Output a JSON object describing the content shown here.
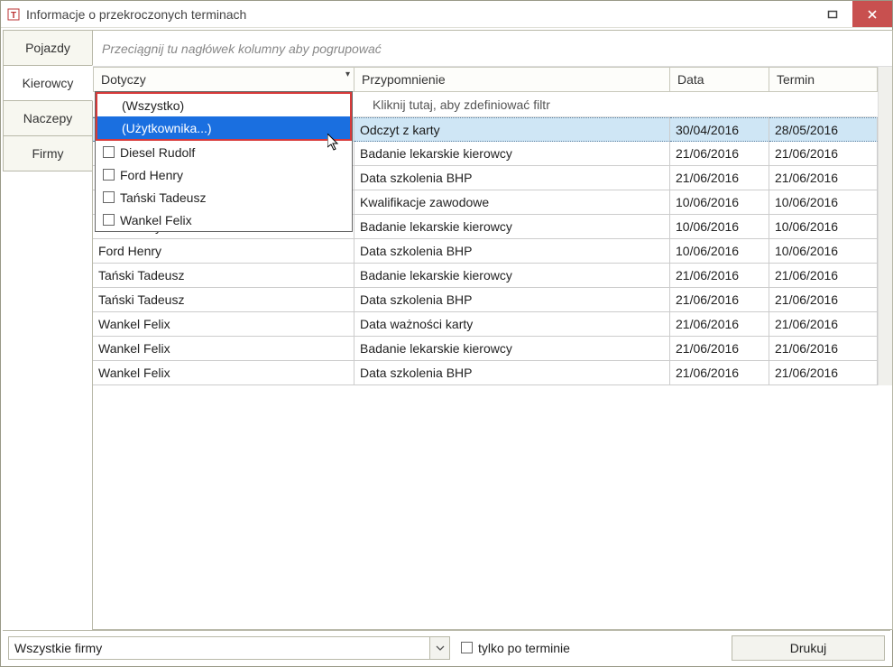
{
  "window": {
    "title": "Informacje o przekroczonych terminach"
  },
  "tabs": [
    {
      "label": "Pojazdy"
    },
    {
      "label": "Kierowcy"
    },
    {
      "label": "Naczepy"
    },
    {
      "label": "Firmy"
    }
  ],
  "active_tab_index": 1,
  "grid": {
    "group_hint": "Przeciągnij tu nagłówek kolumny aby pogrupować",
    "filter_hint": "Kliknij tutaj, aby zdefiniować filtr",
    "columns": [
      {
        "label": "Dotyczy",
        "filterable": true
      },
      {
        "label": "Przypomnienie"
      },
      {
        "label": "Data"
      },
      {
        "label": "Termin"
      }
    ],
    "selected_row_index": 0,
    "rows": [
      {
        "c1": "",
        "c2": "Odczyt z karty",
        "c3": "30/04/2016",
        "c4": "28/05/2016"
      },
      {
        "c1": "",
        "c2": "Badanie lekarskie kierowcy",
        "c3": "21/06/2016",
        "c4": "21/06/2016"
      },
      {
        "c1": "",
        "c2": "Data szkolenia BHP",
        "c3": "21/06/2016",
        "c4": "21/06/2016"
      },
      {
        "c1": "",
        "c2": "Kwalifikacje zawodowe",
        "c3": "10/06/2016",
        "c4": "10/06/2016"
      },
      {
        "c1": "Ford Henry",
        "c2": "Badanie lekarskie kierowcy",
        "c3": "10/06/2016",
        "c4": "10/06/2016"
      },
      {
        "c1": "Ford Henry",
        "c2": "Data szkolenia BHP",
        "c3": "10/06/2016",
        "c4": "10/06/2016"
      },
      {
        "c1": "Tański Tadeusz",
        "c2": "Badanie lekarskie kierowcy",
        "c3": "21/06/2016",
        "c4": "21/06/2016"
      },
      {
        "c1": "Tański Tadeusz",
        "c2": "Data szkolenia BHP",
        "c3": "21/06/2016",
        "c4": "21/06/2016"
      },
      {
        "c1": "Wankel Felix",
        "c2": "Data ważności karty",
        "c3": "21/06/2016",
        "c4": "21/06/2016"
      },
      {
        "c1": "Wankel Felix",
        "c2": "Badanie lekarskie kierowcy",
        "c3": "21/06/2016",
        "c4": "21/06/2016"
      },
      {
        "c1": "Wankel Felix",
        "c2": "Data szkolenia BHP",
        "c3": "21/06/2016",
        "c4": "21/06/2016"
      }
    ]
  },
  "filter_dropdown": {
    "specials": [
      {
        "label": "(Wszystko)"
      },
      {
        "label": "(Użytkownika...)",
        "highlighted": true
      }
    ],
    "items": [
      {
        "label": "Diesel Rudolf"
      },
      {
        "label": "Ford Henry"
      },
      {
        "label": "Tański Tadeusz"
      },
      {
        "label": "Wankel Felix"
      }
    ]
  },
  "footer": {
    "combo_value": "Wszystkie firmy",
    "checkbox_label": "tylko po terminie",
    "print_label": "Drukuj"
  },
  "hidden_row_label": "Ford Henry"
}
